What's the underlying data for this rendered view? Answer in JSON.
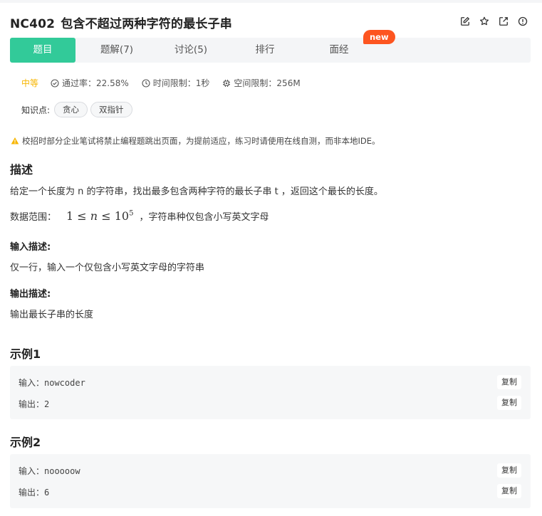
{
  "problem": {
    "code": "NC402",
    "title": "包含不超过两种字符的最长子串"
  },
  "tabs": [
    {
      "label": "题目"
    },
    {
      "label": "题解(7)"
    },
    {
      "label": "讨论(5)"
    },
    {
      "label": "排行"
    },
    {
      "label": "面经"
    }
  ],
  "new_badge": "new",
  "meta": {
    "difficulty": "中等",
    "pass_rate": "通过率：22.58%",
    "time_limit": "时间限制：1秒",
    "space_limit": "空间限制：256M"
  },
  "knowledge": {
    "label": "知识点:",
    "tags": [
      "贪心",
      "双指针"
    ]
  },
  "notice": "校招时部分企业笔试将禁止编程题跳出页面，为提前适应，练习时请使用在线自测，而非本地IDE。",
  "description": {
    "heading": "描述",
    "text": "给定一个长度为 n 的字符串，找出最多包含两种字符的最长子串 t ，返回这个最长的长度。",
    "range_prefix": "数据范围：",
    "range_math": {
      "lhs": "1",
      "op": "≤",
      "var": "n",
      "base": "10",
      "exp": "5"
    },
    "range_suffix": "，字符串种仅包含小写英文字母"
  },
  "input_desc": {
    "heading": "输入描述:",
    "text": "仅一行，输入一个仅包含小写英文字母的字符串"
  },
  "output_desc": {
    "heading": "输出描述:",
    "text": "输出最长子串的长度"
  },
  "examples": [
    {
      "title": "示例1",
      "input": "输入：nowcoder",
      "output": "输出：2",
      "copy_label": "复制"
    },
    {
      "title": "示例2",
      "input": "输入：nooooow",
      "output": "输出：6",
      "copy_label": "复制"
    }
  ]
}
